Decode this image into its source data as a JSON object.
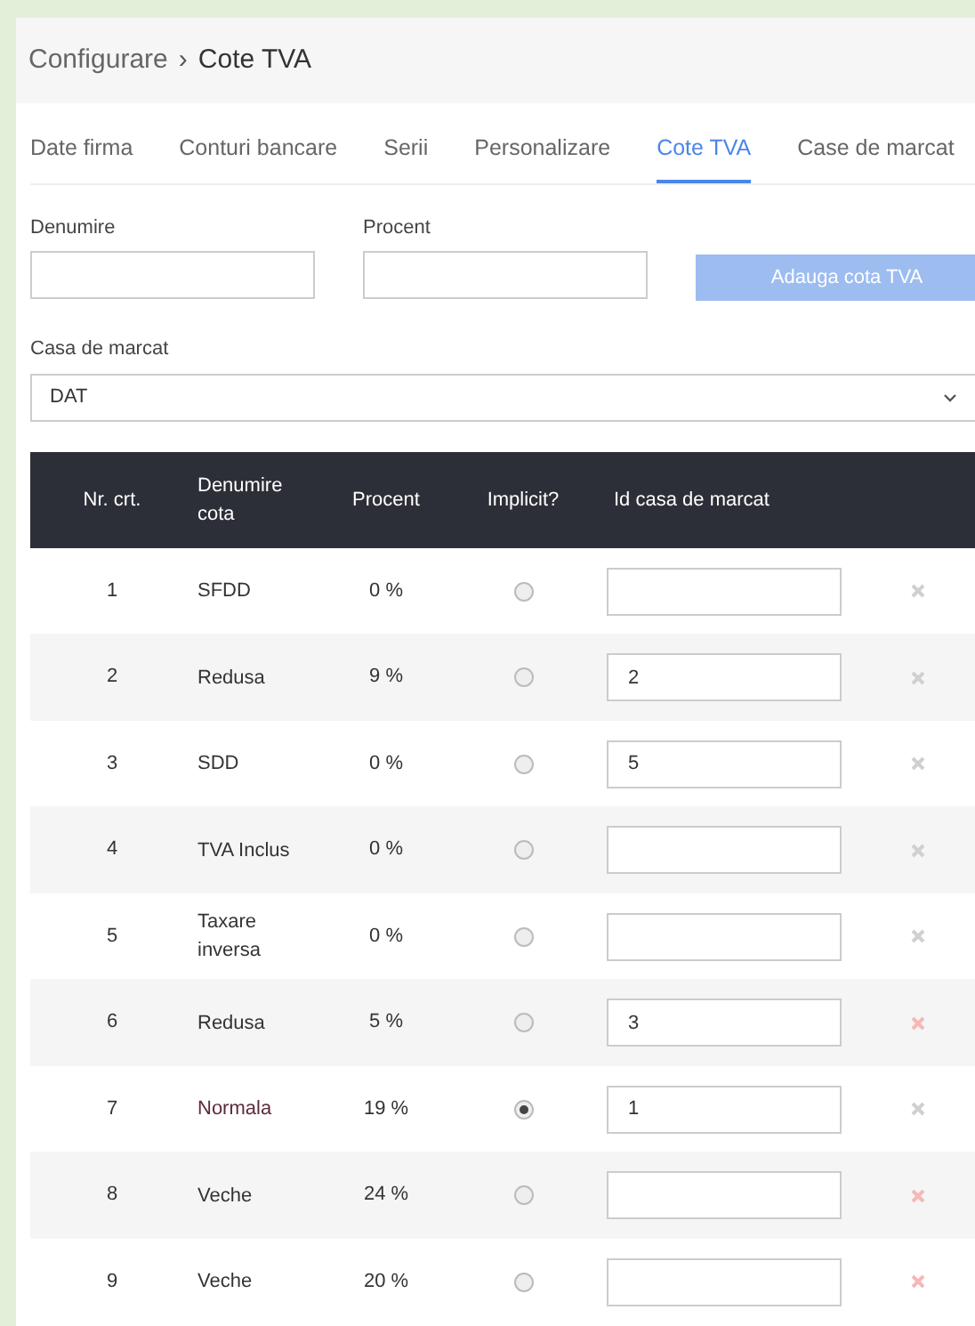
{
  "breadcrumb": {
    "parent": "Configurare",
    "separator": "›",
    "current": "Cote TVA"
  },
  "tabs": [
    {
      "label": "Date firma",
      "selected": false
    },
    {
      "label": "Conturi bancare",
      "selected": false
    },
    {
      "label": "Serii",
      "selected": false
    },
    {
      "label": "Personalizare",
      "selected": false
    },
    {
      "label": "Cote TVA",
      "selected": true
    },
    {
      "label": "Case de marcat",
      "selected": false
    }
  ],
  "form": {
    "name_label": "Denumire",
    "percent_label": "Procent",
    "add_button": {
      "label": "Adauga cota TVA",
      "disabled": true
    },
    "register_label": "Casa de marcat",
    "register_value": "DAT"
  },
  "table": {
    "columns": [
      "Nr. crt.",
      "Denumire cota",
      "Procent",
      "Implicit?",
      "Id casa de marcat"
    ],
    "rows": [
      {
        "nr": "1",
        "name": "SFDD",
        "percent": "0 %",
        "selected": false,
        "register_id": "",
        "color": "#d0d0d0"
      },
      {
        "nr": "2",
        "name": "Redusa",
        "percent": "9 %",
        "selected": false,
        "register_id": "2",
        "color": "#d0d0d0"
      },
      {
        "nr": "3",
        "name": "SDD",
        "percent": "0 %",
        "selected": false,
        "register_id": "5",
        "color": "#d0d0d0"
      },
      {
        "nr": "4",
        "name": "TVA Inclus",
        "percent": "0 %",
        "selected": false,
        "register_id": "",
        "color": "#d0d0d0"
      },
      {
        "nr": "5",
        "name": "Taxare inversa",
        "percent": "0 %",
        "selected": false,
        "register_id": "",
        "color": "#d0d0d0"
      },
      {
        "nr": "6",
        "name": "Redusa",
        "percent": "5 %",
        "selected": false,
        "register_id": "3",
        "color": "#f5b8b8"
      },
      {
        "nr": "7",
        "name": "Normala",
        "percent": "19 %",
        "selected": true,
        "register_id": "1",
        "color": "#d0d0d0"
      },
      {
        "nr": "8",
        "name": "Veche",
        "percent": "24 %",
        "selected": false,
        "register_id": "",
        "color": "#f5b8b8"
      },
      {
        "nr": "9",
        "name": "Veche",
        "percent": "20 %",
        "selected": false,
        "register_id": "",
        "color": "#f5b8b8"
      }
    ]
  }
}
